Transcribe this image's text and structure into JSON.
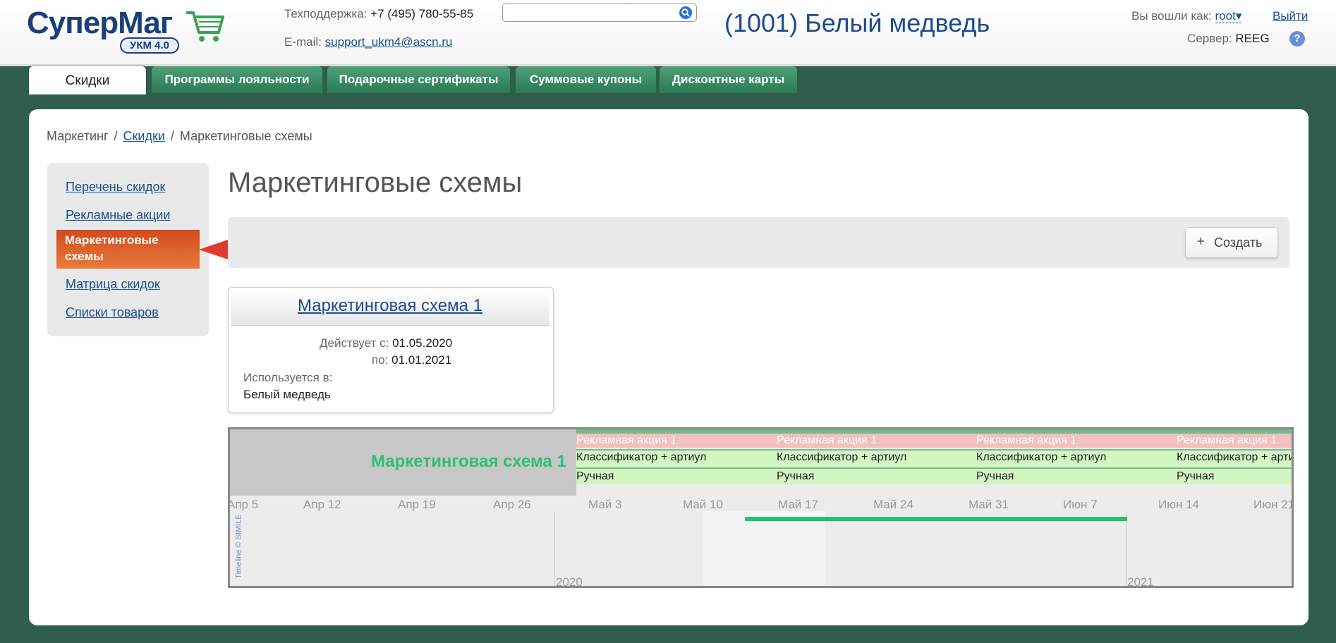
{
  "header": {
    "logo_text": "СуперМаг",
    "logo_badge": "УКМ 4.0",
    "support_label": "Техподдержка:",
    "support_phone": "+7 (495) 780-55-85",
    "email_label": "E-mail:",
    "email": "support_ukm4@ascn.ru",
    "search_value": "",
    "store_title": "(1001) Белый медведь",
    "logged_in_label": "Вы вошли как:",
    "user": "root",
    "logout_label": "Выйти",
    "server_label": "Сервер:",
    "server": "REEG",
    "help_symbol": "?"
  },
  "tabs": [
    {
      "label": "Скидки",
      "active": true
    },
    {
      "label": "Программы лояльности",
      "active": false
    },
    {
      "label": "Подарочные сертификаты",
      "active": false
    },
    {
      "label": "Суммовые купоны",
      "active": false
    },
    {
      "label": "Дисконтные карты",
      "active": false
    }
  ],
  "breadcrumb": {
    "root": "Маркетинг",
    "link": "Скидки",
    "current": "Маркетинговые схемы",
    "separator": "/"
  },
  "sidebar": {
    "items": [
      {
        "label": "Перечень скидок",
        "active": false
      },
      {
        "label": "Рекламные акции",
        "active": false
      },
      {
        "label": "Маркетинговые схемы",
        "active": true
      },
      {
        "label": "Матрица скидок",
        "active": false
      },
      {
        "label": "Списки товаров",
        "active": false
      }
    ]
  },
  "main": {
    "title": "Маркетинговые схемы",
    "create_label": "Создать",
    "create_symbol": "+"
  },
  "card": {
    "title": "Маркетинговая схема 1",
    "valid_from_label": "Действует с:",
    "valid_from": "01.05.2020",
    "valid_to_label": "по:",
    "valid_to": "01.01.2021",
    "used_in_label": "Используется в:",
    "used_in": "Белый медведь"
  },
  "timeline": {
    "scheme_label": "Маркетинговая схема 1",
    "promo": "Рекламная акция 1",
    "classifier": "Классификатор + артиул",
    "manual": "Ручная",
    "weeks": [
      "Апр 5",
      "Апр 12",
      "Апр 19",
      "Апр 26",
      "Май 3",
      "Май 10",
      "Май 17",
      "Май 24",
      "Май 31",
      "Июн 7",
      "Июн 14",
      "Июн 21"
    ],
    "years": [
      "2020",
      "2021"
    ],
    "credit": "Timeline © SIMILE",
    "colors": {
      "bar": "#24bf78",
      "promo": "#f2c0c0",
      "rule": "#d3f5c2",
      "scheme": "#2bbf79"
    }
  }
}
